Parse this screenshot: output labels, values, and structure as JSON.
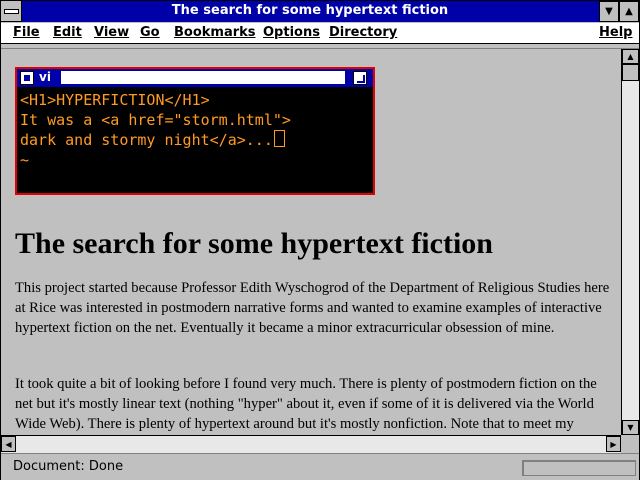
{
  "window": {
    "title": "The search for some hypertext fiction"
  },
  "menus": [
    "File",
    "Edit",
    "View",
    "Go",
    "Bookmarks",
    "Options",
    "Directory",
    "Help"
  ],
  "editor": {
    "title": "vi",
    "lines": [
      "<H1>HYPERFICTION</H1>",
      "It was a <a href=\"storm.html\">",
      "dark and stormy night</a>..."
    ],
    "tilde": "~"
  },
  "page": {
    "heading": "The search for some hypertext fiction",
    "paragraphs": [
      "This project started because Professor Edith Wyschogrod of the Department of Religious Studies here at Rice was interested in postmodern narrative forms and wanted to examine examples of interactive hypertext fiction on the net. Eventually it became a minor extracurricular obsession of mine.",
      "It took quite a bit of looking before I found very much. There is plenty of postmodern fiction on the net but it's mostly linear text (nothing \"hyper\" about it, even if some of it is delivered via the World Wide Web). There is plenty of hypertext around but it's mostly nonfiction. Note that to meet my criteria for \"interactive hypertext fiction\", the work shouldn't be simply a linked narrative, but it should give"
    ]
  },
  "status": {
    "text": "Document: Done",
    "progress": 0
  }
}
